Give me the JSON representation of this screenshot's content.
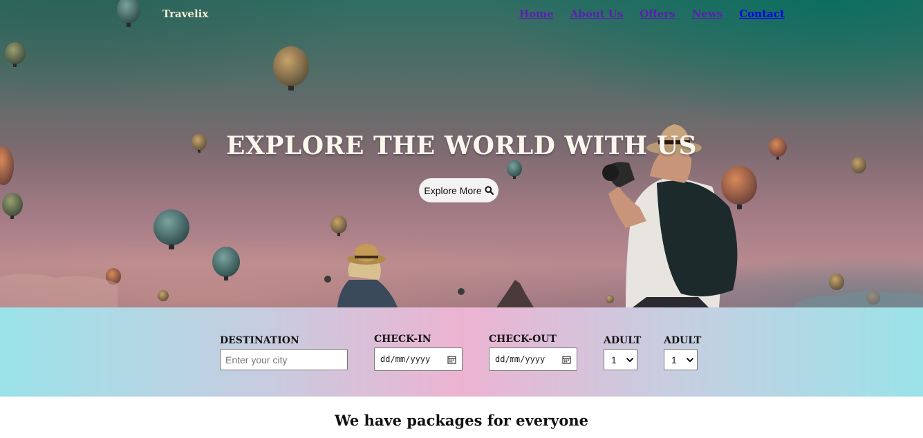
{
  "brand": "Travelix",
  "nav": {
    "home": "Home",
    "about": "About Us",
    "offers": "Offers",
    "news": "News",
    "contact": "Contact"
  },
  "hero": {
    "title": "EXPLORE THE WORLD WITH US",
    "button_label": "Explore More",
    "button_icon": "search-icon"
  },
  "booking": {
    "destination": {
      "label": "DESTINATION",
      "placeholder": "Enter your city"
    },
    "checkin": {
      "label": "CHECK-IN",
      "value": "dd/mm/yyyy",
      "icon": "calendar-icon"
    },
    "checkout": {
      "label": "CHECK-OUT",
      "value": "dd/mm/yyyy",
      "icon": "calendar-icon"
    },
    "adult_1": {
      "label": "ADULT",
      "value": "1",
      "options": [
        "1"
      ]
    },
    "adult_2": {
      "label": "ADULT",
      "value": "1",
      "options": [
        "1"
      ]
    }
  },
  "packages": {
    "title": "We have packages for everyone"
  },
  "colors": {
    "nav_link": "#5b1fb0",
    "nav_link_active": "#0000ee",
    "brand_text": "#f3ead0",
    "booking_gradient": [
      "#9ae2e8",
      "#ecb3d1",
      "#9ae2e8"
    ]
  }
}
